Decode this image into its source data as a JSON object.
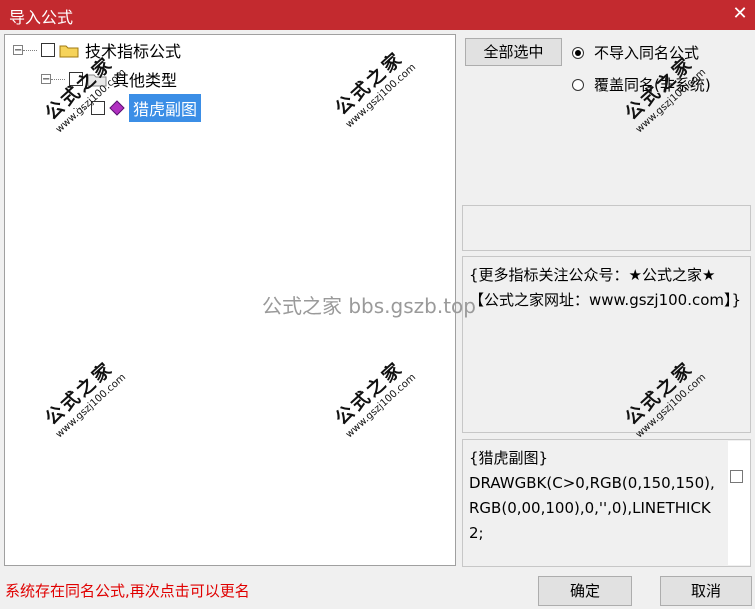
{
  "window": {
    "title": "导入公式",
    "close": "✕"
  },
  "tree": {
    "root": {
      "expander": "⊟",
      "label": "技术指标公式"
    },
    "child": {
      "expander": "⊟",
      "label": "其他类型"
    },
    "leaf": {
      "label": "猎虎副图"
    }
  },
  "controls": {
    "select_all": "全部选中",
    "radio_skip": "不导入同名公式",
    "radio_overwrite": "覆盖同名(非系统)"
  },
  "description": "{更多指标关注公众号：★公式之家★ 【公式之家网址：www.gszj100.com】}",
  "code": "{猎虎副图}\nDRAWGBK(C>0,RGB(0,150,150),RGB(0,00,100),0,'',0),LINETHICK2;",
  "status": "系统存在同名公式,再次点击可以更名",
  "buttons": {
    "ok": "确定",
    "cancel": "取消"
  },
  "watermark": {
    "center": "公式之家 bbs.gszb.top",
    "stamp_title": "公式之家",
    "stamp_url": "www.gszj100.com"
  }
}
